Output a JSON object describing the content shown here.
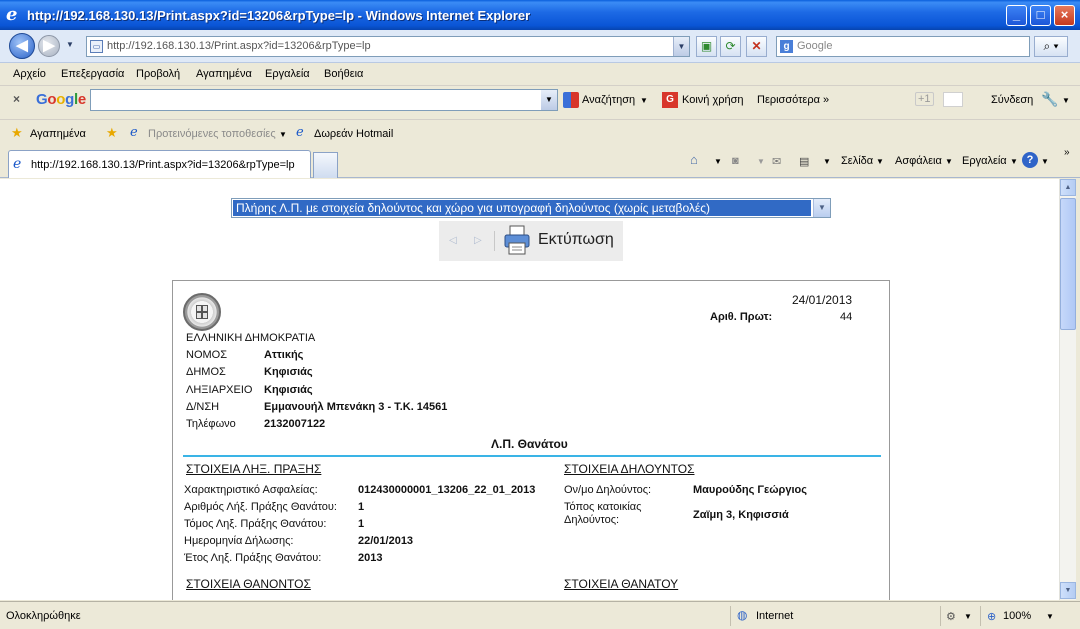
{
  "window": {
    "title": "http://192.168.130.13/Print.aspx?id=13206&rpType=lp - Windows Internet Explorer"
  },
  "nav": {
    "url": "http://192.168.130.13/Print.aspx?id=13206&rpType=lp",
    "search_placeholder": "Google"
  },
  "menu": [
    "Αρχείο",
    "Επεξεργασία",
    "Προβολή",
    "Αγαπημένα",
    "Εργαλεία",
    "Βοήθεια"
  ],
  "google_bar": {
    "close": "×",
    "logo": "Google",
    "search": "Αναζήτηση",
    "share": "Κοινή χρήση",
    "more": "Περισσότερα »",
    "plus": "+1",
    "signin": "Σύνδεση"
  },
  "favorites": {
    "favorites": "Αγαπημένα",
    "suggested": "Προτεινόμενες τοποθεσίες",
    "hotmail": "Δωρεάν Hotmail"
  },
  "tab": {
    "title": "http://192.168.130.13/Print.aspx?id=13206&rpType=lp"
  },
  "commands": {
    "page": "Σελίδα",
    "safety": "Ασφάλεια",
    "tools": "Εργαλεία"
  },
  "report": {
    "selector": "Πλήρης Λ.Π. με στοιχεία δηλούντος και χώρο για υπογραφή δηλούντος (χωρίς μεταβολές)",
    "print_label": "Εκτύπωση",
    "date": "24/01/2013",
    "protocol_label": "Αριθ. Πρωτ:",
    "protocol_value": "44",
    "state": "ΕΛΛΗΝΙΚΗ ΔΗΜΟΚΡΑΤΙΑ",
    "header_rows": [
      {
        "label": "ΝΟΜΟΣ",
        "value": "Αττικής"
      },
      {
        "label": "ΔΗΜΟΣ",
        "value": "Κηφισιάς"
      },
      {
        "label": "ΛΗΞΙΑΡΧΕΙΟ",
        "value": "Κηφισιάς"
      },
      {
        "label": "Δ/ΝΣΗ",
        "value": "Εμμανουήλ Μπενάκη 3 - Τ.Κ. 14561"
      },
      {
        "label": "Τηλέφωνο",
        "value": "2132007122"
      }
    ],
    "doc_title": "Λ.Π. Θανάτου",
    "section_act": "ΣΤΟΙΧΕΙΑ ΛΗΞ. ΠΡΑΞΗΣ",
    "act_rows": [
      {
        "label": "Χαρακτηριστικό Ασφαλείας:",
        "value": "012430000001_13206_22_01_2013"
      },
      {
        "label": "Αριθμός Λήξ. Πράξης Θανάτου:",
        "value": "1"
      },
      {
        "label": "Τόμος Ληξ. Πράξης Θανάτου:",
        "value": "1"
      },
      {
        "label": "Ημερομηνία Δήλωσης:",
        "value": "22/01/2013"
      },
      {
        "label": "Έτος Ληξ. Πράξης Θανάτου:",
        "value": "2013"
      }
    ],
    "section_declarant": "ΣΤΟΙΧΕΙΑ ΔΗΛΟΥΝΤΟΣ",
    "declarant_name_label": "Ον/μο Δηλούντος:",
    "declarant_name": "Μαυρούδης Γεώργιος",
    "declarant_addr_label_1": "Τόπος κατοικίας",
    "declarant_addr_label_2": "Δηλούντος:",
    "declarant_addr": "Ζαϊμη 3, Κηφισσιά",
    "section_deceased": "ΣΤΟΙΧΕΙΑ ΘΑΝΟΝΤΟΣ",
    "section_death": "ΣΤΟΙΧΕΙΑ ΘΑΝΑΤΟΥ"
  },
  "status": {
    "text": "Ολοκληρώθηκε",
    "zone": "Internet",
    "zoom": "100%"
  }
}
